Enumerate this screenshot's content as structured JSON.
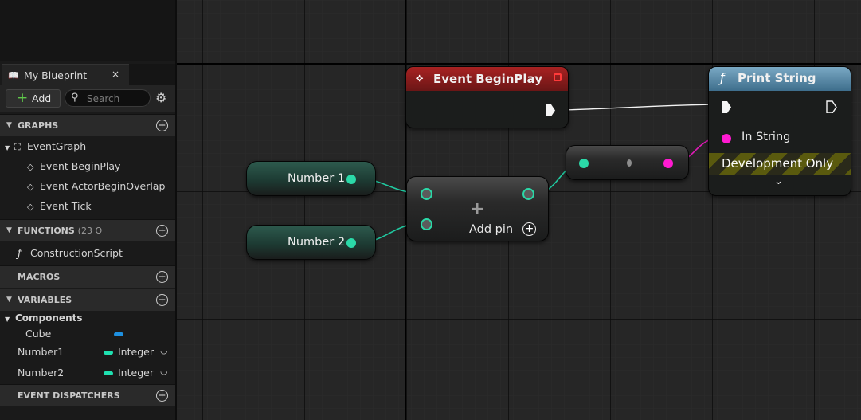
{
  "panel": {
    "tab_title": "My Blueprint",
    "tab_close": "×",
    "add_label": "Add",
    "search_placeholder": "Search",
    "sections": {
      "graphs": "GRAPHS",
      "functions": "FUNCTIONS",
      "functions_extra": "(23 O",
      "macros": "MACROS",
      "variables": "VARIABLES",
      "dispatchers": "EVENT DISPATCHERS"
    },
    "graphs": {
      "event_graph": "EventGraph",
      "events": [
        "Event BeginPlay",
        "Event ActorBeginOverlap",
        "Event Tick"
      ]
    },
    "functions": [
      "ConstructionScript"
    ],
    "variables": {
      "components_label": "Components",
      "components": [
        {
          "name": "Cube",
          "color": "#1e90e0"
        }
      ],
      "vars": [
        {
          "name": "Number1",
          "type": "Integer",
          "color": "#1fe0b0"
        },
        {
          "name": "Number2",
          "type": "Integer",
          "color": "#1fe0b0"
        }
      ]
    }
  },
  "graph": {
    "begin_play": {
      "title": "Event BeginPlay",
      "header_color": "#a82222"
    },
    "print_string": {
      "title": "Print String",
      "header_color": "#6f9dba",
      "in_string_label": "In String",
      "dev_only_label": "Development Only"
    },
    "number1_label": "Number 1",
    "number2_label": "Number 2",
    "add_node": {
      "add_pin_label": "Add pin"
    },
    "colors": {
      "integer_pin": "#2bd9a8",
      "string_pin": "#ff1ad1",
      "exec": "#f5f5f5"
    }
  }
}
